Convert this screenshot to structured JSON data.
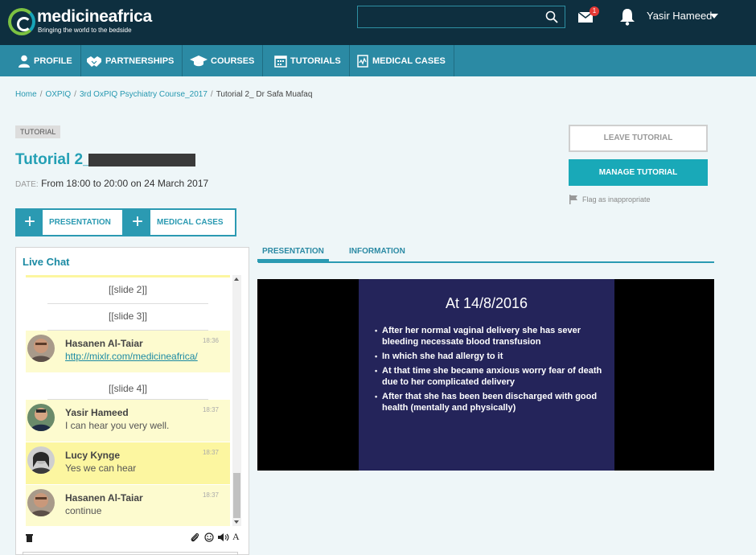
{
  "brand": {
    "name": "medicineafrica",
    "tagline": "Bringing the world to the bedside"
  },
  "header": {
    "search_placeholder": "",
    "mail_badge": "1",
    "user_name": "Yasir Hameed"
  },
  "nav": {
    "items": [
      {
        "label": "PROFILE",
        "icon": "person-icon"
      },
      {
        "label": "PARTNERSHIPS",
        "icon": "handshake-icon"
      },
      {
        "label": "COURSES",
        "icon": "graduation-cap-icon"
      },
      {
        "label": "TUTORIALS",
        "icon": "calendar-icon"
      },
      {
        "label": "MEDICAL CASES",
        "icon": "medical-chart-icon"
      }
    ]
  },
  "breadcrumb": {
    "home": "Home",
    "level1": "OXPIQ",
    "level2": "3rd OxPIQ Psychiatry Course_2017",
    "current": "Tutorial 2_ Dr Safa Muafaq"
  },
  "tutorial": {
    "badge": "TUTORIAL",
    "title": "Tutorial 2_",
    "date_label": "DATE:",
    "date_value": "From 18:00 to 20:00 on 24 March 2017"
  },
  "add_buttons": {
    "presentation": "PRESENTATION",
    "medical_cases": "MEDICAL CASES",
    "plus": "+"
  },
  "actions": {
    "leave": "LEAVE TUTORIAL",
    "manage": "MANAGE TUTORIAL",
    "flag": "Flag as inappropriate"
  },
  "chat": {
    "title": "Live Chat",
    "slides": [
      "[[slide 2]]",
      "[[slide 3]]",
      "[[slide 4]]"
    ],
    "messages": [
      {
        "name": "Hasanen Al-Taiar",
        "time": "18:36",
        "text": "http://mixlr.com/medicineafrica/"
      },
      {
        "name": "Yasir Hameed",
        "time": "18:37",
        "text": "I can hear you very well."
      },
      {
        "name": "Lucy Kynge",
        "time": "18:37",
        "text": "Yes we can hear"
      },
      {
        "name": "Hasanen Al-Taiar",
        "time": "18:37",
        "text": "continue"
      }
    ],
    "font_tool": "A"
  },
  "tabs": {
    "presentation": "PRESENTATION",
    "information": "INFORMATION"
  },
  "slide": {
    "title": "At 14/8/2016",
    "bullets": [
      "After her normal vaginal delivery she has sever bleeding necessate blood  transfusion",
      "In which she had allergy to it",
      "At that time she became anxious worry fear of death due to her complicated delivery",
      "After that she has been been discharged with good health (mentally and physically)"
    ]
  },
  "colors": {
    "header_bg": "#0e2f3f",
    "nav_bg": "#2b8aa4",
    "accent": "#24a0b5",
    "manage_btn": "#19a9b8",
    "slide_bg": "#24245a"
  }
}
